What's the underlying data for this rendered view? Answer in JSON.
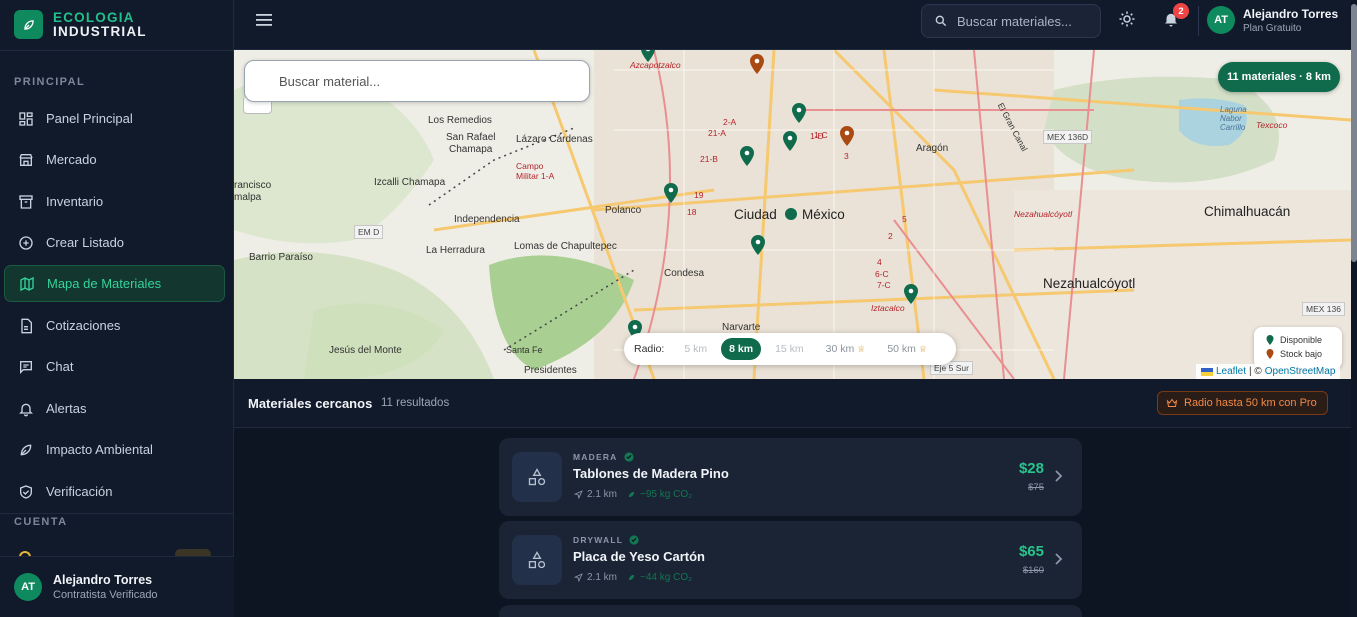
{
  "brand": {
    "line1": "ECOLOGIA",
    "line2": "INDUSTRIAL"
  },
  "sidebar": {
    "section_principal": "PRINCIPAL",
    "section_cuenta": "CUENTA",
    "items": [
      {
        "label": "Panel Principal",
        "icon": "grid-icon"
      },
      {
        "label": "Mercado",
        "icon": "store-icon"
      },
      {
        "label": "Inventario",
        "icon": "archive-icon"
      },
      {
        "label": "Crear Listado",
        "icon": "plus-circle-icon"
      },
      {
        "label": "Mapa de Materiales",
        "icon": "map-icon",
        "active": true
      },
      {
        "label": "Cotizaciones",
        "icon": "document-icon"
      },
      {
        "label": "Chat",
        "icon": "chat-icon"
      },
      {
        "label": "Alertas",
        "icon": "bell-icon"
      },
      {
        "label": "Impacto Ambiental",
        "icon": "leaf-icon"
      },
      {
        "label": "Verificación",
        "icon": "shield-check-icon"
      }
    ],
    "user": {
      "initials": "AT",
      "name": "Alejandro Torres",
      "role": "Contratista Verificado"
    }
  },
  "topbar": {
    "search_placeholder": "Buscar materiales...",
    "notification_count": "2",
    "user": {
      "initials": "AT",
      "name": "Alejandro Torres",
      "plan": "Plan Gratuito"
    }
  },
  "map": {
    "search_placeholder": "Buscar material...",
    "count_badge": "11 materiales · 8 km",
    "radius_label": "Radio:",
    "radius_options": [
      "5 km",
      "8 km",
      "15 km",
      "30 km",
      "50 km"
    ],
    "radius_selected": "8 km",
    "legend": {
      "available": "Disponible",
      "low_stock": "Stock bajo"
    },
    "attribution": {
      "leaflet": "Leaflet",
      "sep": "| ©",
      "osm": "OpenStreetMap"
    },
    "places": {
      "los_remedios": "Los Remedios",
      "san_rafael": "San Rafael",
      "chamapa": "Chamapa",
      "lazaro": "Lázaro Cárdenas",
      "campo_militar": "Campo Militar 1-A",
      "izcalli": "Izcalli Chamapa",
      "independencia": "Independencia",
      "polanco": "Polanco",
      "ciudad": "Ciudad",
      "mexico": "México",
      "azcapotzalco": "Azcapotzalco",
      "aragon": "Aragón",
      "chimalhuacan": "Chimalhuacán",
      "nezahualcoyotl": "Nezahualcóyotl",
      "nezahualcoyotl_road": "Nezahualcóyotl",
      "la_herradura": "La Herradura",
      "lomas": "Lomas de Chapultepec",
      "condesa": "Condesa",
      "barrio_paraiso": "Barrio Paraíso",
      "jesus_del_monte": "Jesús del Monte",
      "santa_fe": "Santa Fe",
      "presidentes": "Presidentes",
      "narvarte": "Narvarte",
      "iztacalco": "Iztacalco",
      "laguna": "Laguna Nabor Carrillo",
      "texcoco": "Texcoco",
      "francisco": "rancisco",
      "malpa": "malpa",
      "el_gran_canal": "El Gran Canal"
    },
    "shields": [
      "EM D",
      "MEX 136D",
      "MEX 136",
      "Eje 5 Sur"
    ],
    "road_marks": [
      "2-A",
      "1-C",
      "1-D",
      "21-A",
      "21-B",
      "19",
      "18",
      "6-C",
      "7-C",
      "5",
      "3",
      "4",
      "2"
    ]
  },
  "list": {
    "title": "Materiales cercanos",
    "count": "11 resultados",
    "pro_button": "Radio hasta 50 km con Pro",
    "items": [
      {
        "category": "MADERA",
        "name": "Tablones de Madera Pino",
        "distance": "2.1 km",
        "co2": "~95 kg CO₂",
        "price": "$28",
        "old_price": "$75"
      },
      {
        "category": "DRYWALL",
        "name": "Placa de Yeso Cartón",
        "distance": "2.1 km",
        "co2": "~44 kg CO₂",
        "price": "$65",
        "old_price": "$160"
      }
    ]
  },
  "colors": {
    "accent": "#0f6b4c",
    "accent_light": "#27c48b",
    "low_stock": "#a84a12",
    "badge": "#ef4444"
  }
}
